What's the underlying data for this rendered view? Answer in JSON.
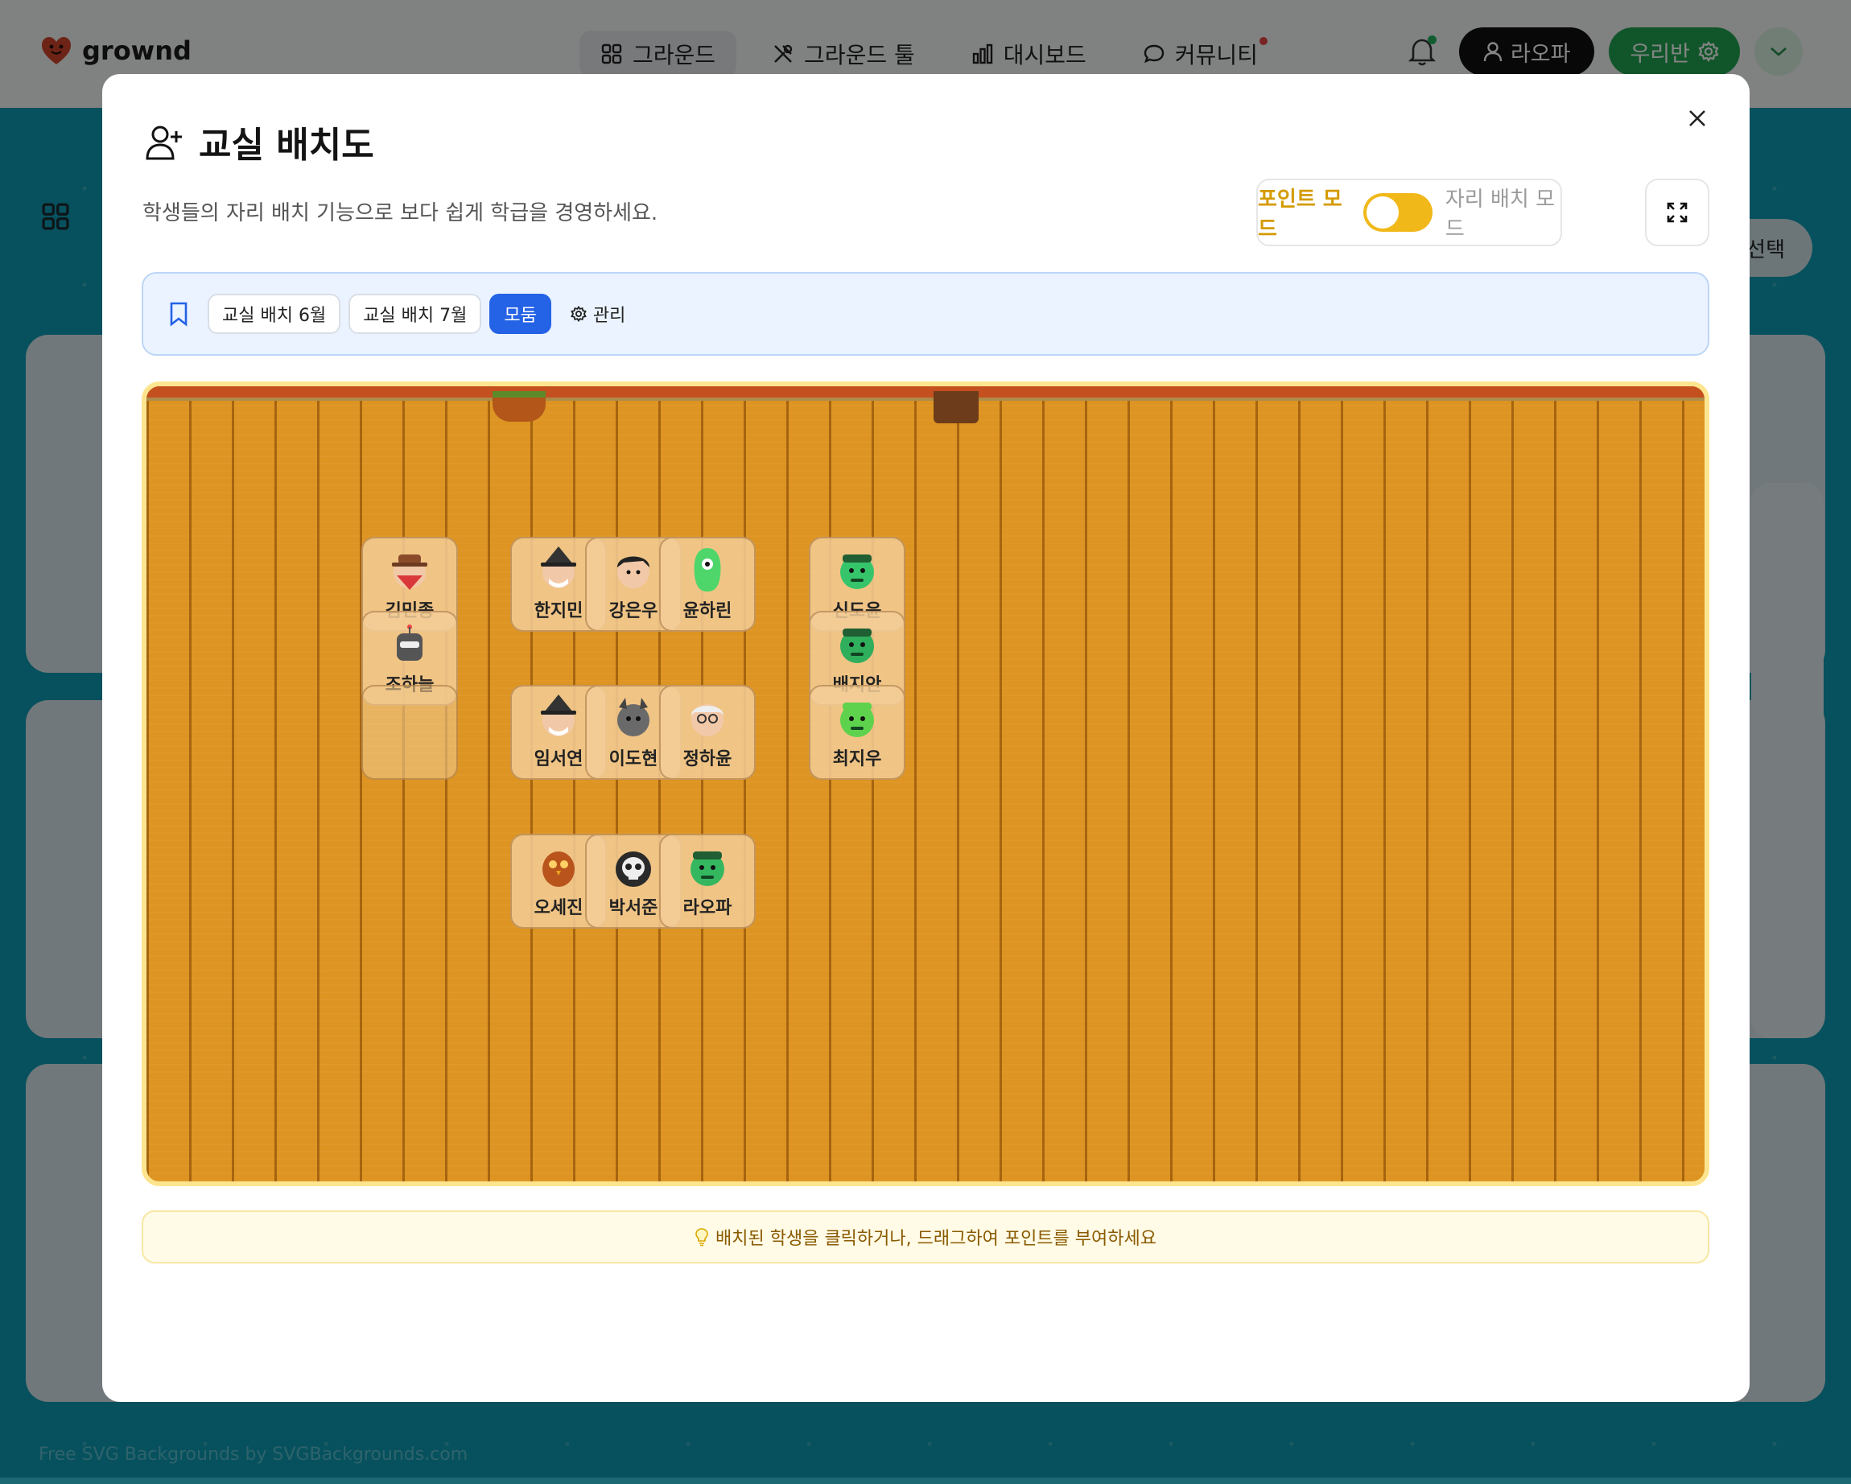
{
  "app": {
    "brand": "grownd",
    "nav": [
      {
        "label": "그라운드",
        "icon": "grid-icon"
      },
      {
        "label": "그라운드 툴",
        "icon": "tools-icon"
      },
      {
        "label": "대시보드",
        "icon": "bar-chart-icon"
      },
      {
        "label": "커뮤니티",
        "icon": "chat-icon"
      }
    ],
    "user_label": "라오파",
    "class_label": "우리반",
    "background_select_label": "선택",
    "footer_credit": "Free SVG Backgrounds by SVGBackgrounds.com"
  },
  "modal": {
    "title": "교실 배치도",
    "description": "학생들의 자리 배치 기능으로 보다 쉽게 학급을 경영하세요.",
    "mode_point": "포인트 모드",
    "mode_seat": "자리 배치 모드",
    "layouts": [
      "교실 배치 6월",
      "교실 배치 7월",
      "모둠"
    ],
    "selected_layout": "모둠",
    "manage_label": "관리",
    "hint": "배치된 학생을 클릭하거나, 드래그하여 포인트를 부여하세요"
  },
  "seats": [
    {
      "name": "김민종",
      "avatar": "cowboy-bandit-avatar-icon",
      "color": "#d9383a"
    },
    {
      "name": "조하늘",
      "avatar": "robot-avatar-icon",
      "color": "#4a4a4a"
    },
    {
      "name": "",
      "avatar": "",
      "color": ""
    },
    {
      "name": "한지민",
      "avatar": "witch-avatar-icon",
      "color": "#333333"
    },
    {
      "name": "강은우",
      "avatar": "boy-avatar-icon",
      "color": "#222222"
    },
    {
      "name": "윤하린",
      "avatar": "green-alien-avatar-icon",
      "color": "#4fd66b"
    },
    {
      "name": "신도윤",
      "avatar": "green-monster-avatar-icon",
      "color": "#36c46a"
    },
    {
      "name": "배지안",
      "avatar": "frankenstein-avatar-icon",
      "color": "#2fae5b"
    },
    {
      "name": "최지우",
      "avatar": "frog-avatar-icon",
      "color": "#5fd24d"
    },
    {
      "name": "임서연",
      "avatar": "witch-avatar-icon",
      "color": "#333333"
    },
    {
      "name": "이도현",
      "avatar": "gargoyle-avatar-icon",
      "color": "#6a6a6a"
    },
    {
      "name": "정하윤",
      "avatar": "grandpa-avatar-icon",
      "color": "#dddddd"
    },
    {
      "name": "오세진",
      "avatar": "owl-avatar-icon",
      "color": "#b8541c"
    },
    {
      "name": "박서준",
      "avatar": "skull-avatar-icon",
      "color": "#2a2a2a"
    },
    {
      "name": "라오파",
      "avatar": "orc-avatar-icon",
      "color": "#35b760"
    }
  ]
}
